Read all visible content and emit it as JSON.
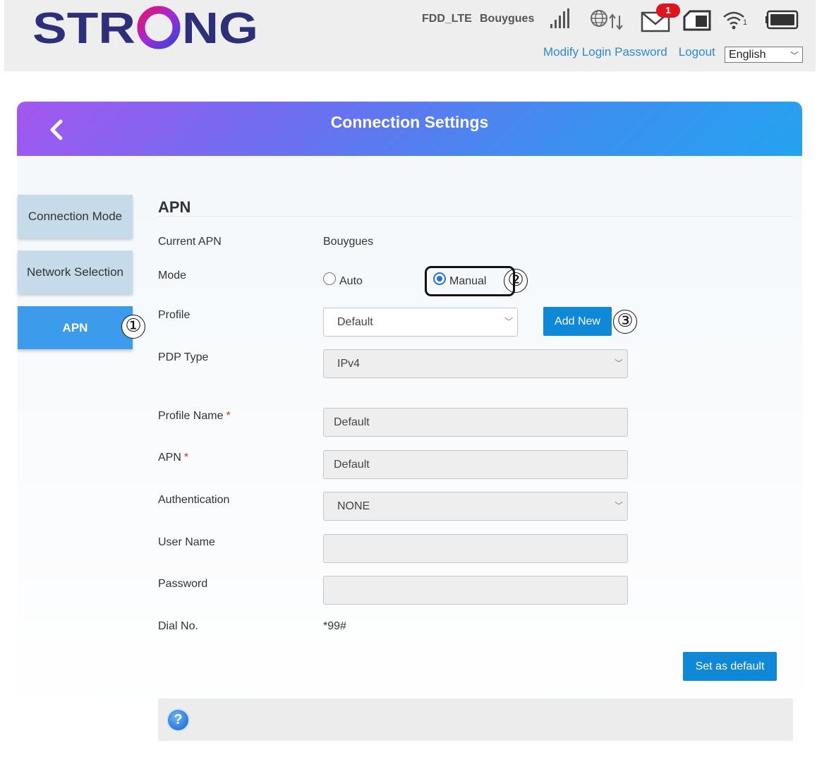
{
  "header": {
    "logo_text": "STRONG",
    "network_type": "FDD_LTE",
    "operator": "Bouygues",
    "message_badge": "1",
    "wifi_clients": "1",
    "modify_password_link": "Modify Login Password",
    "logout_link": "Logout",
    "language": "English"
  },
  "page": {
    "title": "Connection Settings"
  },
  "sidebar": {
    "items": [
      {
        "label": "Connection Mode",
        "active": false
      },
      {
        "label": "Network Selection",
        "active": false
      },
      {
        "label": "APN",
        "active": true
      }
    ]
  },
  "annotations": [
    "①",
    "②",
    "③"
  ],
  "apn": {
    "section_title": "APN",
    "current_apn_label": "Current APN",
    "current_apn_value": "Bouygues",
    "mode_label": "Mode",
    "mode_auto": "Auto",
    "mode_manual": "Manual",
    "mode_selected": "Manual",
    "profile_label": "Profile",
    "profile_value": "Default",
    "add_new_button": "Add New",
    "pdp_type_label": "PDP Type",
    "pdp_type_value": "IPv4",
    "profile_name_label": "Profile Name",
    "profile_name_value": "Default",
    "apn_label": "APN",
    "apn_value": "Default",
    "required_mark": "*",
    "authentication_label": "Authentication",
    "authentication_value": "NONE",
    "user_name_label": "User Name",
    "user_name_value": "",
    "password_label": "Password",
    "password_value": "",
    "dial_no_label": "Dial No.",
    "dial_no_value": "*99#",
    "set_default_button": "Set as default"
  },
  "help": {
    "icon": "?"
  },
  "colors": {
    "accent_blue": "#0f88d8",
    "active_tab": "#3d9bec",
    "inactive_tab": "#c6dbe9",
    "gradient_start": "#a457f1",
    "gradient_end": "#23a3ef",
    "badge_red": "#e0141e",
    "link_blue": "#2b8ad8"
  }
}
